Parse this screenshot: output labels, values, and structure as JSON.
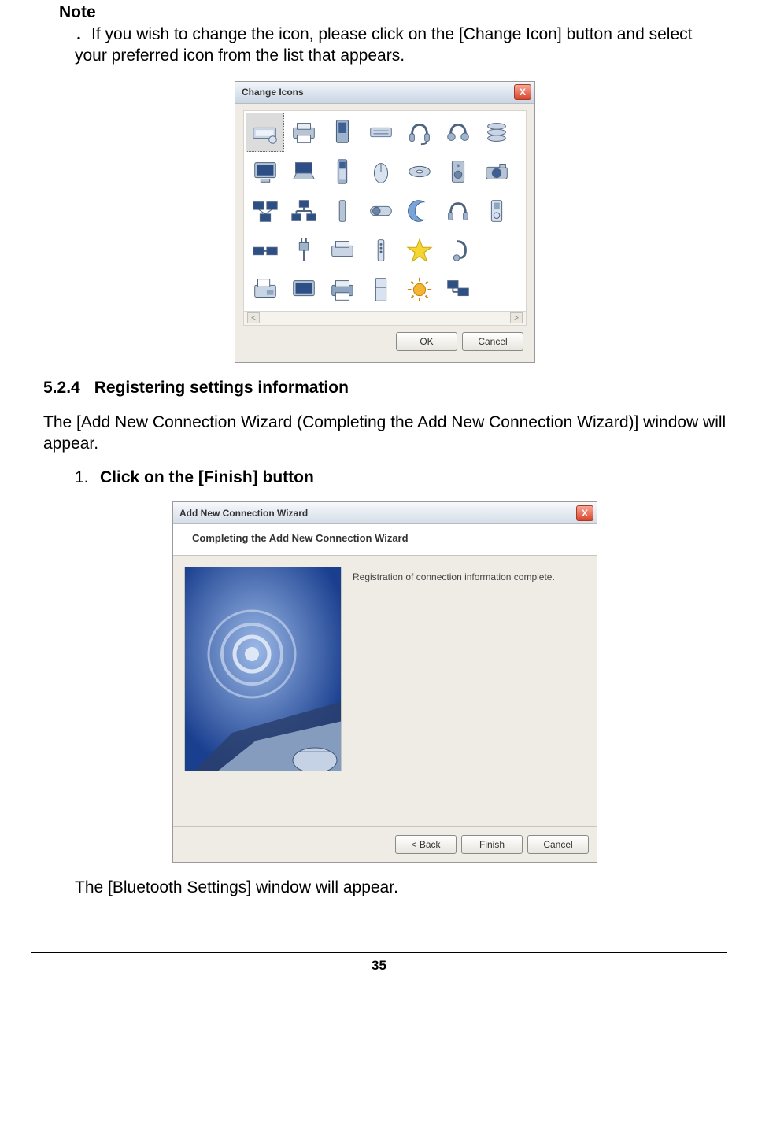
{
  "note": {
    "heading": "Note",
    "body_prefix": "．",
    "body": "If you wish to change the icon, please click on the [Change Icon] button and select your preferred icon from the list that appears."
  },
  "change_icons": {
    "title": "Change Icons",
    "ok_label": "OK",
    "cancel_label": "Cancel",
    "scroll_left": "<",
    "scroll_right": ">",
    "close_glyph": "X",
    "icons": [
      "keyboard",
      "printer",
      "pda",
      "keypad",
      "headset-mic",
      "headphones",
      "disc-stack",
      "monitor",
      "laptop",
      "phone",
      "mouse",
      "disc",
      "speaker",
      "camera",
      "network",
      "lan",
      "stick",
      "toggle",
      "moon",
      "headset",
      "ipod",
      "router",
      "plug",
      "print2",
      "remote",
      "star",
      "earpiece",
      "",
      "fax",
      "monitor2",
      "printer3",
      "fridge",
      "sun",
      "multi",
      ""
    ]
  },
  "section": {
    "number": "5.2.4",
    "heading": "Registering settings information",
    "intro": "The [Add New Connection Wizard (Completing the Add New Connection Wizard)] window will appear.",
    "step_number": "1.",
    "step_text": "Click on the [Finish] button",
    "result": "The [Bluetooth Settings] window will appear."
  },
  "wizard": {
    "title": "Add New Connection Wizard",
    "header": "Completing the Add New Connection Wizard",
    "message": "Registration of connection information complete.",
    "back_label": "< Back",
    "finish_label": "Finish",
    "cancel_label": "Cancel",
    "close_glyph": "X"
  },
  "page_number": "35"
}
